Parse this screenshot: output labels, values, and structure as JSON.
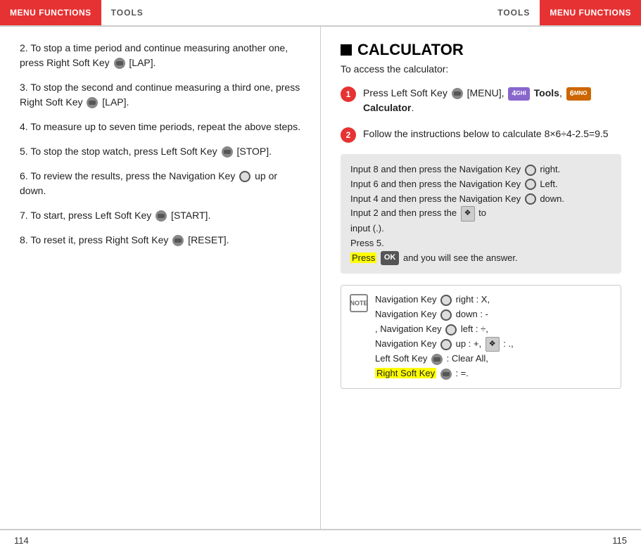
{
  "header": {
    "left_menu": "MENU FUNCTIONS",
    "left_tools": "TOOLS",
    "right_tools": "TOOLS",
    "right_menu": "MENU FUNCTIONS"
  },
  "left_page": {
    "steps": [
      {
        "number": "2",
        "text": "To stop a time period and continue measuring another one, press Right Soft Key [LAP]."
      },
      {
        "number": "3",
        "text": "To stop the second and continue measuring a third one, press Right Soft Key [LAP]."
      },
      {
        "number": "4",
        "text": "To measure up to seven time periods, repeat the above steps."
      },
      {
        "number": "5",
        "text": "To stop the stop watch, press Left Soft Key [STOP]."
      },
      {
        "number": "6",
        "text": "To review the results, press the Navigation Key up or down."
      },
      {
        "number": "7",
        "text": "To start, press Left Soft Key [START]."
      },
      {
        "number": "8",
        "text": "To reset it, press Right Soft Key [RESET]."
      }
    ]
  },
  "right_page": {
    "title": "CALCULATOR",
    "subtitle": "To access the calculator:",
    "steps": [
      {
        "number": "1",
        "text_parts": [
          "Press Left Soft Key",
          "[MENU],",
          "Tools,",
          "Calculator."
        ],
        "keys": [
          "4 GHI",
          "6 MNO"
        ]
      },
      {
        "number": "2",
        "text": "Follow the instructions below to calculate 8×6÷4-2.5=9.5"
      }
    ],
    "instruction_box": {
      "lines": [
        "Input 8 and then press the Navigation Key right.",
        "Input 6 and then press the Navigation Key Left.",
        "Input 4 and then press the Navigation Key down.",
        "Input 2 and then press the",
        "to input (.).",
        "Press 5.",
        "Press and you will see the answer."
      ]
    },
    "note": {
      "lines": [
        "Navigation Key right : X,",
        "Navigation Key down : -",
        ", Navigation Key left : ÷,",
        "Navigation Key up : +,",
        ": .,",
        "Left Soft Key : Clear All,",
        "Right Soft Key : =."
      ]
    }
  },
  "footer": {
    "left_page_num": "114",
    "right_page_num": "115"
  }
}
